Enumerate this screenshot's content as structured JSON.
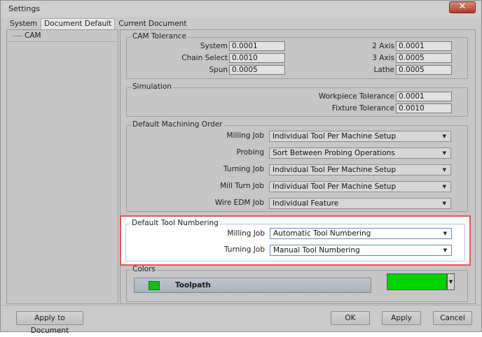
{
  "window": {
    "title": "Settings",
    "close_glyph": "✕"
  },
  "tabs": [
    {
      "label": "System"
    },
    {
      "label": "Document Default"
    },
    {
      "label": "Current Document"
    }
  ],
  "tree": {
    "items": [
      {
        "label": "CAM"
      }
    ]
  },
  "cam_tolerance": {
    "title": "CAM Tolerance",
    "system": {
      "label": "System",
      "value": "0.0001"
    },
    "chain_select": {
      "label": "Chain Select",
      "value": "0.0010"
    },
    "spun": {
      "label": "Spun",
      "value": "0.0005"
    },
    "axis2": {
      "label": "2 Axis",
      "value": "0.0001"
    },
    "axis3": {
      "label": "3 Axis",
      "value": "0.0005"
    },
    "lathe": {
      "label": "Lathe",
      "value": "0.0005"
    }
  },
  "simulation": {
    "title": "Simulation",
    "workpiece": {
      "label": "Workpiece Tolerance",
      "value": "0.0001"
    },
    "fixture": {
      "label": "Fixture Tolerance",
      "value": "0.0010"
    }
  },
  "machining_order": {
    "title": "Default Machining Order",
    "rows": [
      {
        "label": "Milling Job",
        "value": "Individual Tool Per Machine Setup"
      },
      {
        "label": "Probing",
        "value": "Sort Between Probing Operations"
      },
      {
        "label": "Turning Job",
        "value": "Individual Tool Per Machine Setup"
      },
      {
        "label": "Mill Turn Job",
        "value": "Individual Tool Per Machine Setup"
      },
      {
        "label": "Wire EDM Job",
        "value": "Individual Feature"
      }
    ]
  },
  "tool_numbering": {
    "title": "Default Tool Numbering",
    "rows": [
      {
        "label": "Milling Job",
        "value": "Automatic Tool Numbering"
      },
      {
        "label": "Turning Job",
        "value": "Manual Tool Numbering"
      }
    ]
  },
  "colors": {
    "title": "Colors",
    "toolpath_label": "Toolpath",
    "toolpath_color": "#00d400"
  },
  "buttons": {
    "apply_to_document": "Apply to Document",
    "ok": "OK",
    "apply": "Apply",
    "cancel": "Cancel"
  },
  "icons": {
    "dropdown": "chevron-down-icon",
    "close": "close-icon"
  },
  "theme": {
    "highlight_border": "#e05757",
    "dialog_bg": "#c9c9c9"
  }
}
